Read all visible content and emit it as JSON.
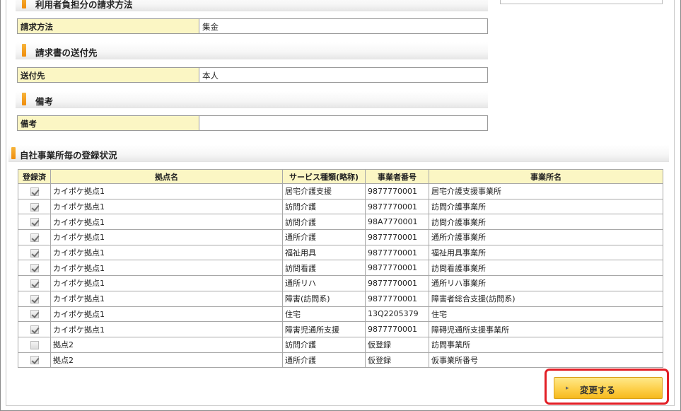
{
  "sections": {
    "billing_method": {
      "title": "利用者負担分の請求方法",
      "label": "請求方法",
      "value": "集金"
    },
    "invoice_destination": {
      "title": "請求書の送付先",
      "label": "送付先",
      "value": "本人"
    },
    "notes": {
      "title": "備考",
      "label": "備考",
      "value": ""
    }
  },
  "registration": {
    "title": "自社事業所毎の登録状況",
    "columns": {
      "registered": "登録済",
      "base_name": "拠点名",
      "service_type": "サービス種類(略称)",
      "provider_number": "事業者番号",
      "office_name": "事業所名"
    },
    "rows": [
      {
        "checked": true,
        "base": "カイポケ拠点1",
        "service": "居宅介護支援",
        "number": "9877770001",
        "office": "居宅介護支援事業所"
      },
      {
        "checked": true,
        "base": "カイポケ拠点1",
        "service": "訪問介護",
        "number": "9877770001",
        "office": "訪問介護事業所"
      },
      {
        "checked": true,
        "base": "カイポケ拠点1",
        "service": "訪問介護",
        "number": "98A7770001",
        "office": "訪問介護事業所"
      },
      {
        "checked": true,
        "base": "カイポケ拠点1",
        "service": "通所介護",
        "number": "9877770001",
        "office": "通所介護事業所"
      },
      {
        "checked": true,
        "base": "カイポケ拠点1",
        "service": "福祉用具",
        "number": "9877770001",
        "office": "福祉用具事業所"
      },
      {
        "checked": true,
        "base": "カイポケ拠点1",
        "service": "訪問看護",
        "number": "9877770001",
        "office": "訪問看護事業所"
      },
      {
        "checked": true,
        "base": "カイポケ拠点1",
        "service": "通所リハ",
        "number": "9877770001",
        "office": "通所リハ事業所"
      },
      {
        "checked": true,
        "base": "カイポケ拠点1",
        "service": "障害(訪問系)",
        "number": "9877770001",
        "office": "障害者総合支援(訪問系)"
      },
      {
        "checked": true,
        "base": "カイポケ拠点1",
        "service": "住宅",
        "number": "13Q2205379",
        "office": "住宅"
      },
      {
        "checked": true,
        "base": "カイポケ拠点1",
        "service": "障害児通所支援",
        "number": "9877770001",
        "office": "障碍児通所支援事業所"
      },
      {
        "checked": false,
        "base": "拠点2",
        "service": "訪問介護",
        "number": "仮登録",
        "office": "訪問事業所"
      },
      {
        "checked": true,
        "base": "拠点2",
        "service": "通所介護",
        "number": "仮登録",
        "office": "仮事業所番号"
      }
    ]
  },
  "actions": {
    "change_label": "変更する"
  }
}
